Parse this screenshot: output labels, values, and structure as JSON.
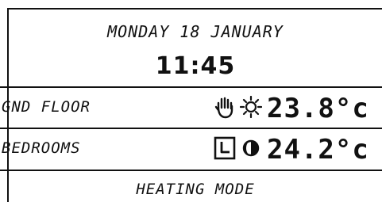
{
  "display": {
    "date": "MONDAY 18 JANUARY",
    "time": "11:45",
    "footer": "HEATING MODE"
  },
  "zones": [
    {
      "name": "GND FLOOR",
      "mode_icon": "hand-icon",
      "state_icon": "sun-icon",
      "temperature": "23.8°c"
    },
    {
      "name": "BEDROOMS",
      "mode_icon": "clock-icon",
      "state_icon": "half-moon-icon",
      "temperature": "24.2°c"
    }
  ],
  "colors": {
    "background": "#ffffff",
    "foreground": "#111111"
  }
}
